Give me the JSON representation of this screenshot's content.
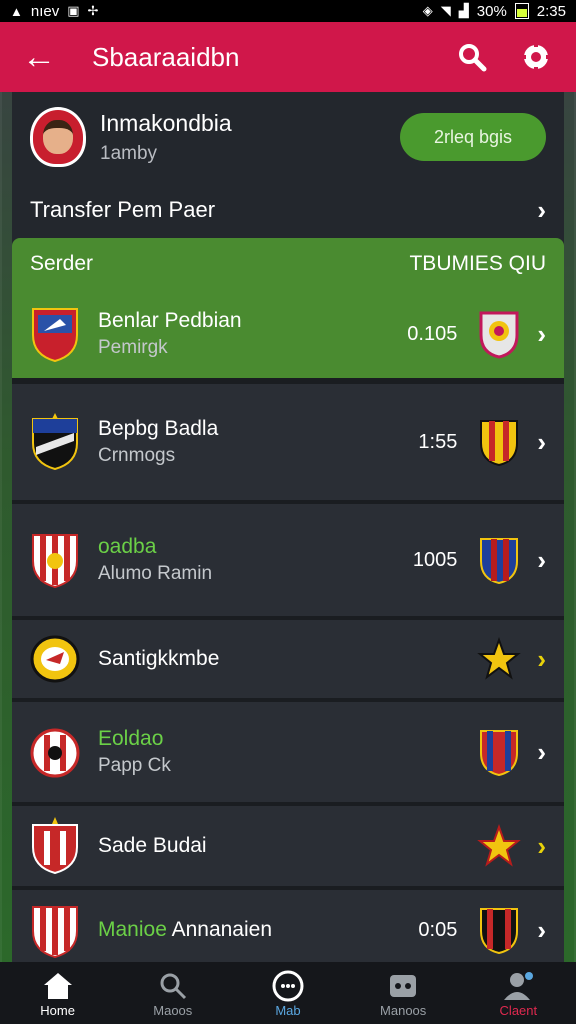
{
  "statusbar": {
    "left_text": "nıev",
    "time": "2:35",
    "battery_text": "30%"
  },
  "appbar": {
    "title": "Sbaaraaidbn"
  },
  "profile": {
    "name": "Inmakondbia",
    "subtitle": "1amby",
    "button_label": "2rleq bgis"
  },
  "transfer": {
    "label": "Transfer Pem Paer"
  },
  "section": {
    "left": "Serder",
    "right": "TBUMIES QIU"
  },
  "rows": [
    {
      "title": "Benlar Pedbian",
      "subtitle": "Pemirgk",
      "value": "0.105"
    },
    {
      "title": "Bepbg Badla",
      "subtitle": "Crnmogs",
      "value": "1:55"
    },
    {
      "title": "oadba",
      "subtitle": "Alumo Ramin",
      "value": "1005"
    },
    {
      "title": "Santigkkmbe",
      "subtitle": "",
      "value": ""
    },
    {
      "title": "Eoldao",
      "subtitle": "Papp Ck",
      "value": ""
    },
    {
      "title": "Sade Budai",
      "subtitle": "",
      "value": ""
    },
    {
      "title": "Manioe",
      "title_extra": "Annanaien",
      "subtitle": "",
      "value": "0:05"
    }
  ],
  "nav": [
    {
      "label": "Home"
    },
    {
      "label": "Maoos"
    },
    {
      "label": "Mab"
    },
    {
      "label": "Manoos"
    },
    {
      "label": "Claent"
    }
  ],
  "colors": {
    "appbar": "#d0174a",
    "accent_green": "#4a8b30",
    "highlight_text_green": "#6bd047",
    "chevron_yellow": "#e8d20a"
  }
}
